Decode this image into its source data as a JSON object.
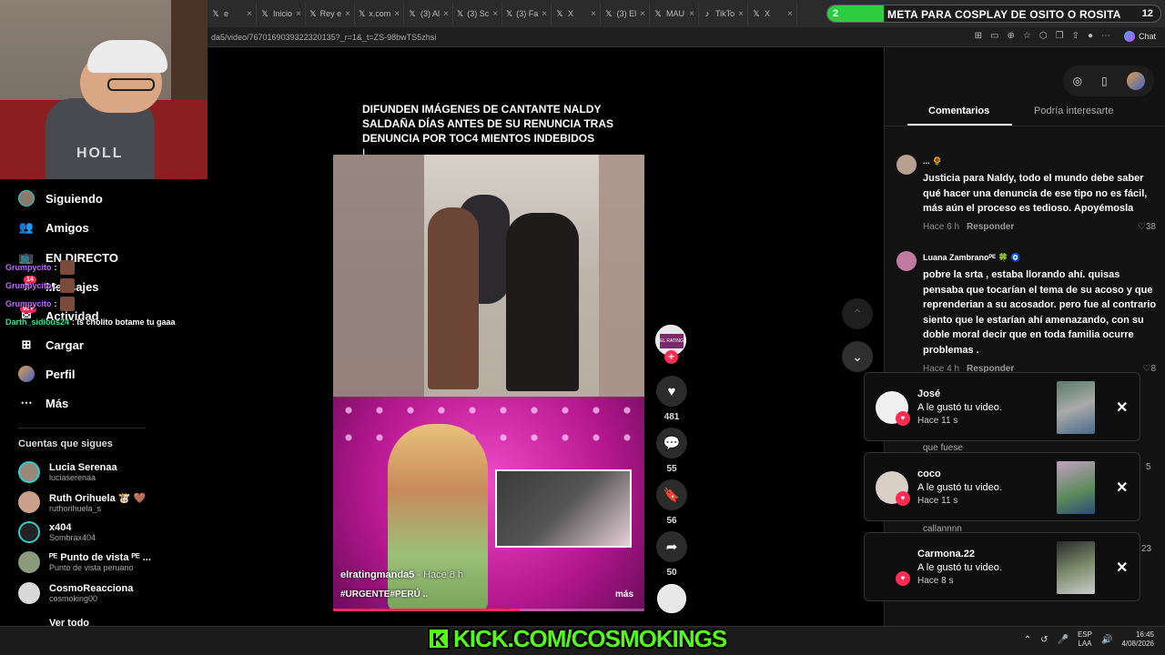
{
  "browser": {
    "tabs": [
      {
        "icon": "x-icon",
        "label": "e"
      },
      {
        "icon": "x-icon",
        "label": "Inicio"
      },
      {
        "icon": "x-icon",
        "label": "Rey e"
      },
      {
        "icon": "x-icon",
        "label": "x.com"
      },
      {
        "icon": "x-icon",
        "label": "(3) Al"
      },
      {
        "icon": "x-icon",
        "label": "(3) Sc"
      },
      {
        "icon": "x-icon",
        "label": "(3) Fa"
      },
      {
        "icon": "x-icon",
        "label": "X"
      },
      {
        "icon": "x-icon",
        "label": "(3) El"
      },
      {
        "icon": "x-icon",
        "label": "MAU"
      },
      {
        "icon": "tiktok-icon",
        "label": "TikTo"
      },
      {
        "icon": "x-icon",
        "label": "X"
      }
    ],
    "url": "da5/video/7670169039322320135?_r=1&_t=ZS-98bwTS5zhsi",
    "chat_label": "Chat"
  },
  "stream_goal": {
    "start": "2",
    "title": "META PARA COSPLAY DE OSITO O ROSITA",
    "end": "12",
    "progress": 0.17,
    "color": "#2ecc40"
  },
  "webcam": {
    "shirt_text": "HOLL"
  },
  "sidebar": {
    "nav": [
      {
        "label": "Siguiendo",
        "icon": "avatar"
      },
      {
        "label": "Amigos",
        "icon": "friends-icon"
      },
      {
        "label": "EN DIRECTO",
        "icon": "live-icon"
      },
      {
        "label": "Mensajes",
        "icon": "messages-icon"
      },
      {
        "label": "Actividad",
        "icon": "activity-icon"
      },
      {
        "label": "Cargar",
        "icon": "upload-icon"
      },
      {
        "label": "Perfil",
        "icon": "profile-icon"
      },
      {
        "label": "Más",
        "icon": "more-icon"
      }
    ],
    "badges": {
      "messages": "14",
      "activity": "99+"
    },
    "following_heading": "Cuentas que sigues",
    "following": [
      {
        "name": "Lucia Serenaa",
        "handle": "luciaserenaa"
      },
      {
        "name": "Ruth Orihuela 🐮 🤎",
        "handle": "ruthorihuela_s"
      },
      {
        "name": "x404",
        "handle": "Sombrax404"
      },
      {
        "name": "ᴾᴱ Punto de vista ᴾᴱ ...",
        "handle": "Punto de vista peruano"
      },
      {
        "name": "CosmoReacciona",
        "handle": "cosmoking00"
      },
      {
        "name": "Ver todo",
        "handle": ""
      }
    ]
  },
  "chat_overlay": [
    {
      "user": "Grumpycito",
      "msg": ":"
    },
    {
      "user": "Grumpycito",
      "msg": ":"
    },
    {
      "user": "Grumpycito",
      "msg": ":"
    },
    {
      "user": "Darth_sidious24",
      "msg": ": Is cholito botame tu gaaa"
    }
  ],
  "video": {
    "caption_lines": [
      "DIFUNDEN IMÁGENES DE CANTANTE NALDY",
      "SALDAÑA DÍAS ANTES DE SU RENUNCIA TRAS",
      "DENUNCIA POR TOC4 MIENTOS INDEBIDOS"
    ],
    "caption_cursor": "I",
    "author": "elratingmanda5",
    "time_ago": "· Hace 8 h",
    "tags": "#URGENTE#PERÚ ..",
    "more": "más",
    "progress": 0.6,
    "author_avatar_text": "EL RATING MANDA"
  },
  "actions": {
    "likes": "481",
    "comments": "55",
    "saves": "56",
    "shares": "50"
  },
  "comments_panel": {
    "tab_active": "Comentarios",
    "tab_inactive": "Podría interesarte",
    "comments": [
      {
        "name": "... 🌻",
        "text": "Justicia para Naldy, todo el mundo debe saber qué hacer una denuncia de ese tipo no es fácil, más aún el proceso es tedioso. Apoyémosla",
        "time": "Hace 6 h",
        "reply": "Responder",
        "likes": "38"
      },
      {
        "name": "Luana Zambranoᴾᴱ 🍀 🧿",
        "text": "pobre la srta , estaba llorando ahí. quisas pensaba que tocarían el tema de su acoso y que reprenderian a su acosador. pero fue al contrario siento que le estarían ahí amenazando, con su doble moral decir que en toda familia ocurre problemas .",
        "time": "Hace 4 h",
        "reply": "Responder",
        "likes": "8"
      }
    ],
    "fragments": {
      "a": "que fuese",
      "b": "callannnn",
      "c": "5",
      "d": "23"
    }
  },
  "notifications": [
    {
      "name": "José",
      "text": "A le gustó tu video.",
      "time": "Hace 11 s"
    },
    {
      "name": "coco",
      "text": "A le gustó tu video.",
      "time": "Hace 11 s"
    },
    {
      "name": "Carmona.22",
      "text": "A le gustó tu video.",
      "time": "Hace 8 s"
    }
  ],
  "taskbar": {
    "kick_text": "KICK.COM/COSMOKINGS",
    "kick_logo": "K",
    "lang_top": "ESP",
    "lang_bottom": "LAA",
    "time": "16:45",
    "date": "4/08/2026"
  },
  "colors": {
    "accent": "#fe2c55",
    "kick": "#53fc18"
  }
}
